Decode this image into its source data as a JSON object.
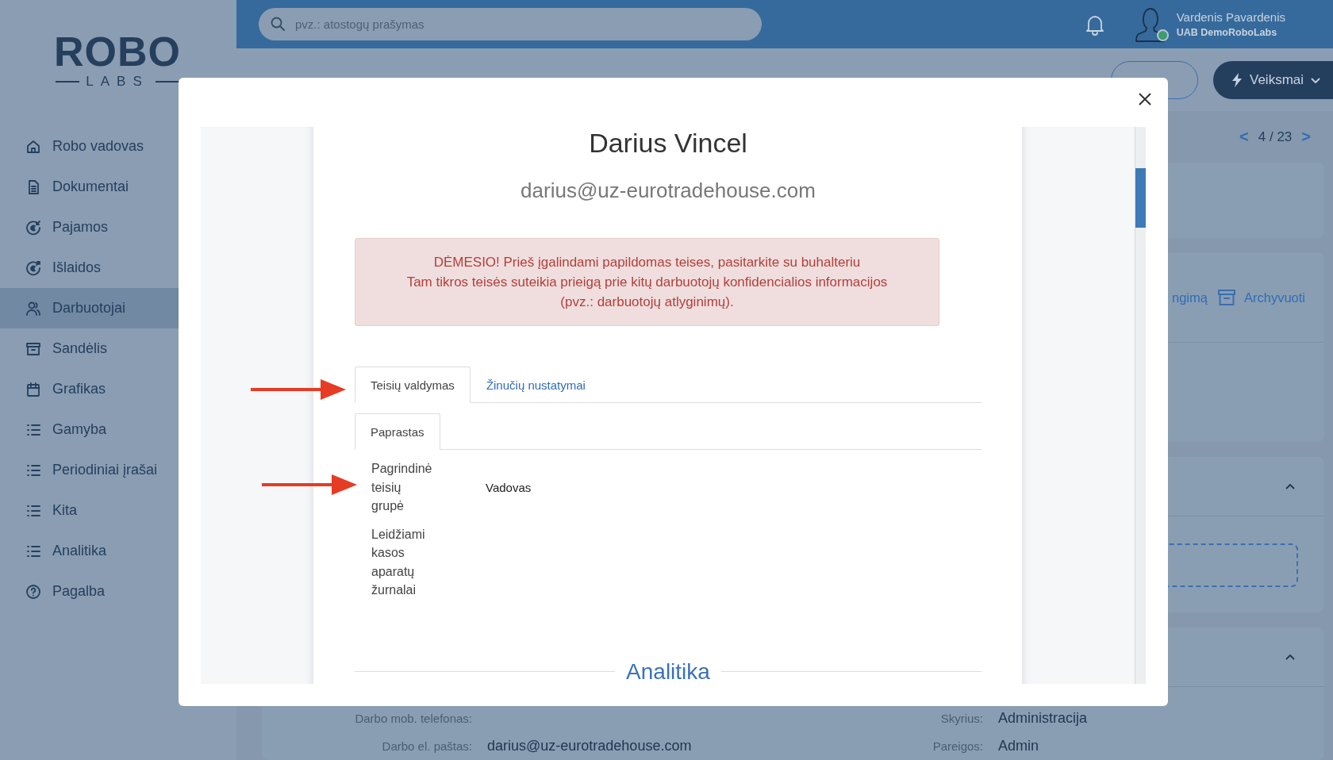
{
  "sidebar": {
    "logo": {
      "word": "ROBO",
      "tagline": "LABS"
    },
    "items": [
      {
        "label": "Robo vadovas",
        "selected": false
      },
      {
        "label": "Dokumentai",
        "selected": false
      },
      {
        "label": "Pajamos",
        "selected": false
      },
      {
        "label": "Išlaidos",
        "selected": false
      },
      {
        "label": "Darbuotojai",
        "selected": true
      },
      {
        "label": "Sandėlis",
        "selected": false
      },
      {
        "label": "Grafikas",
        "selected": false
      },
      {
        "label": "Gamyba",
        "selected": false
      },
      {
        "label": "Periodiniai įrašai",
        "selected": false
      },
      {
        "label": "Kita",
        "selected": false
      },
      {
        "label": "Analitika",
        "selected": false
      },
      {
        "label": "Pagalba",
        "selected": false
      }
    ]
  },
  "topbar": {
    "search": {
      "placeholder": "pvz.: atostogų prašymas"
    },
    "user": {
      "name": "Vardenis Pavardenis",
      "company": "UAB DemoRoboLabs",
      "online": true
    }
  },
  "header": {
    "actions_button": "Veiksmai"
  },
  "pager": {
    "previous": "<",
    "position": "4 / 23",
    "next": ">"
  },
  "employee_card": {
    "actions": [
      "ngimą",
      "Archyvuoti"
    ]
  },
  "details": {
    "left": [
      {
        "label": "Darbo mob. telefonas:"
      },
      {
        "label": "Darbo el. paštas:",
        "value": "darius@uz-eurotradehouse.com"
      }
    ],
    "right": [
      {
        "label": "Skyrius:",
        "value": "Administracija"
      },
      {
        "label": "Pareigos:",
        "value": "Admin"
      }
    ]
  },
  "modal": {
    "title": "Darius Vincel",
    "email": "darius@uz-eurotradehouse.com",
    "alert": [
      "DĖMESIO! Prieš įgalindami papildomas teises, pasitarkite su buhalteriu",
      "Tam tikros teisės suteikia prieigą prie kitų darbuotojų konfidencialios informacijos",
      "(pvz.: darbuotojų atlyginimų)."
    ],
    "tabs": [
      {
        "label": "Teisių valdymas",
        "selected": true
      },
      {
        "label": "Žinučių nustatymai",
        "selected": false
      }
    ],
    "subtabs": [
      {
        "label": "Paprastas",
        "selected": true
      }
    ],
    "fields": [
      {
        "label": "Pagrindinė teisių grupė",
        "value": "Vadovas"
      },
      {
        "label": "Leidžiami kasos aparatų žurnalai"
      }
    ],
    "section_heading": "Analitika"
  }
}
